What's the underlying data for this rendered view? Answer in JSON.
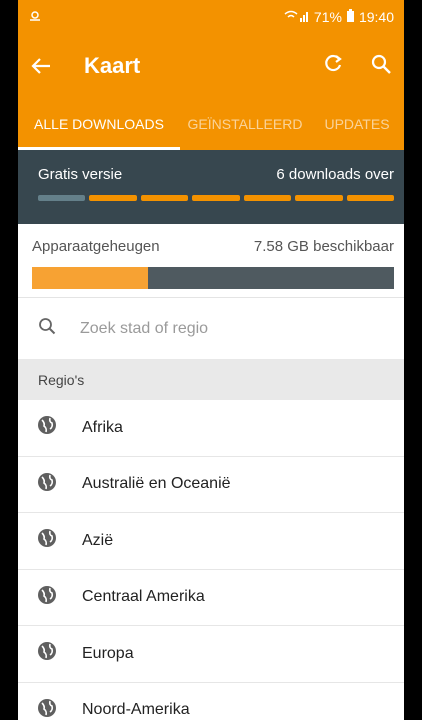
{
  "status_bar": {
    "left_icon": "location-pin-icon",
    "signal": "wifi-signal-icon",
    "battery": "71%",
    "time": "19:40"
  },
  "app_bar": {
    "title": "Kaart",
    "back_icon": "arrow-left-icon",
    "refresh_icon": "refresh-icon",
    "search_icon": "search-icon"
  },
  "tabs": [
    {
      "label": "ALLE DOWNLOADS",
      "active": true
    },
    {
      "label": "GEÏNSTALLEERD",
      "active": false
    },
    {
      "label": "UPDATES",
      "active": false
    }
  ],
  "version": {
    "label": "Gratis versie",
    "downloads": "6 downloads over",
    "segments_total": 7,
    "segments_used": 1
  },
  "storage": {
    "label": "Apparaatgeheugen",
    "available": "7.58 GB beschikbaar",
    "used_fraction": 0.32
  },
  "search": {
    "placeholder": "Zoek stad of regio"
  },
  "section": {
    "title": "Regio's"
  },
  "regions": [
    {
      "label": "Afrika"
    },
    {
      "label": "Australië en Oceanië"
    },
    {
      "label": "Azië"
    },
    {
      "label": "Centraal Amerika"
    },
    {
      "label": "Europa"
    },
    {
      "label": "Noord-Amerika"
    }
  ],
  "colors": {
    "accent": "#f39200",
    "dark_panel": "#37474f"
  }
}
